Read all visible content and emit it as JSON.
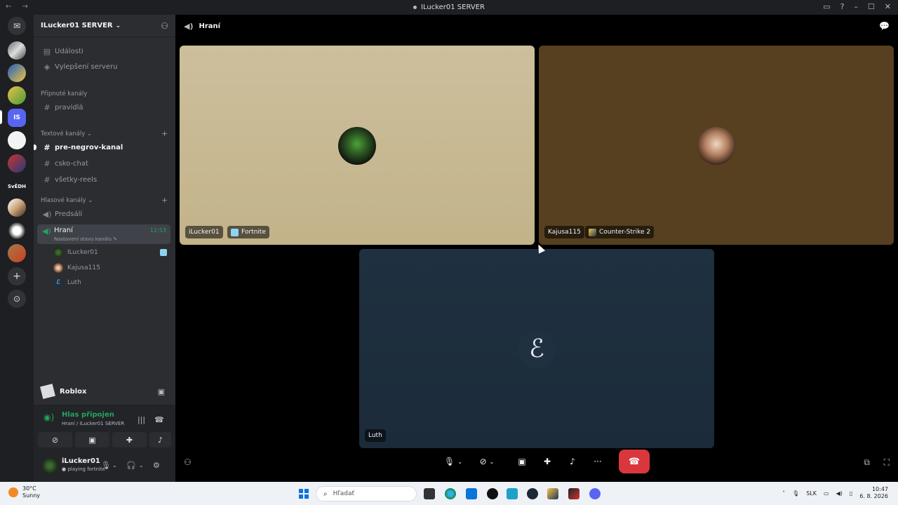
{
  "window": {
    "title": "ILucker01 SERVER",
    "nav": "← →",
    "controls": [
      "▭",
      "?",
      "–",
      "☐",
      "✕"
    ]
  },
  "server": {
    "name": "ILucker01 SERVER",
    "chevron": "⌄",
    "rail_label": "SvĚDH"
  },
  "sidebar": {
    "top_items": [
      {
        "label": "Události",
        "icon": "calendar-icon"
      },
      {
        "label": "Vylepšení serveru",
        "icon": "boost-icon"
      }
    ],
    "pinned_category": "Připnuté kanály",
    "pinned_channels": [
      "pravidlá"
    ],
    "text_category": "Textové kanály",
    "text_channels": [
      "pre-negrov-kanal",
      "csko-chat",
      "všetky-reels"
    ],
    "voice_category": "Hlasové kanály",
    "voice_channels": [
      "Predsálí"
    ],
    "active_voice": {
      "name": "Hraní",
      "status": "Nastavení stavu kanálu",
      "time": "12:53"
    },
    "voice_users": [
      "ILucker01",
      "Kajusa115",
      "Luth"
    ]
  },
  "activity": {
    "label": "Roblox"
  },
  "voice_panel": {
    "connected": "Hlas připojen",
    "location": "Hraní / ILucker01 SERVER"
  },
  "user_panel": {
    "name": "iLucker01",
    "status": "playing fortnite"
  },
  "main": {
    "channel": "Hraní",
    "tiles": [
      {
        "user": "iLucker01",
        "game": "Fortnite",
        "color": "#c4b58c"
      },
      {
        "user": "Kajusa115",
        "game": "Counter-Strike 2",
        "color": "#56401f"
      },
      {
        "user": "Luth",
        "game": "",
        "color": "#1f3040"
      }
    ]
  },
  "taskbar": {
    "weather_temp": "30°C",
    "weather_desc": "Sunny",
    "search_placeholder": "Hľadať",
    "lang": "SLK",
    "time": "10:47",
    "date": "6. 8. 2026"
  },
  "colors": {
    "accent_green": "#23a55a",
    "end_call_red": "#da373c",
    "sidebar_bg": "#2b2d31",
    "rail_bg": "#1e1f22"
  }
}
